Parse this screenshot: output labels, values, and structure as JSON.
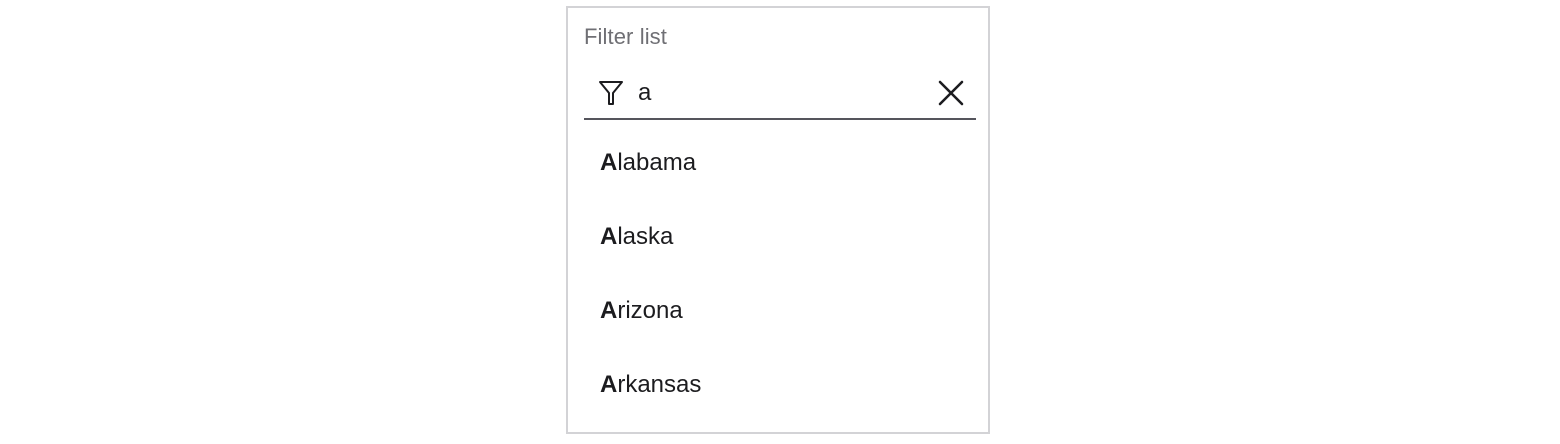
{
  "filter": {
    "label": "Filter list",
    "query": "a",
    "filter_icon": "filter-icon",
    "clear_icon": "close-icon"
  },
  "results": [
    {
      "match": "A",
      "rest": "labama"
    },
    {
      "match": "A",
      "rest": "laska"
    },
    {
      "match": "A",
      "rest": "rizona"
    },
    {
      "match": "A",
      "rest": "rkansas"
    }
  ]
}
